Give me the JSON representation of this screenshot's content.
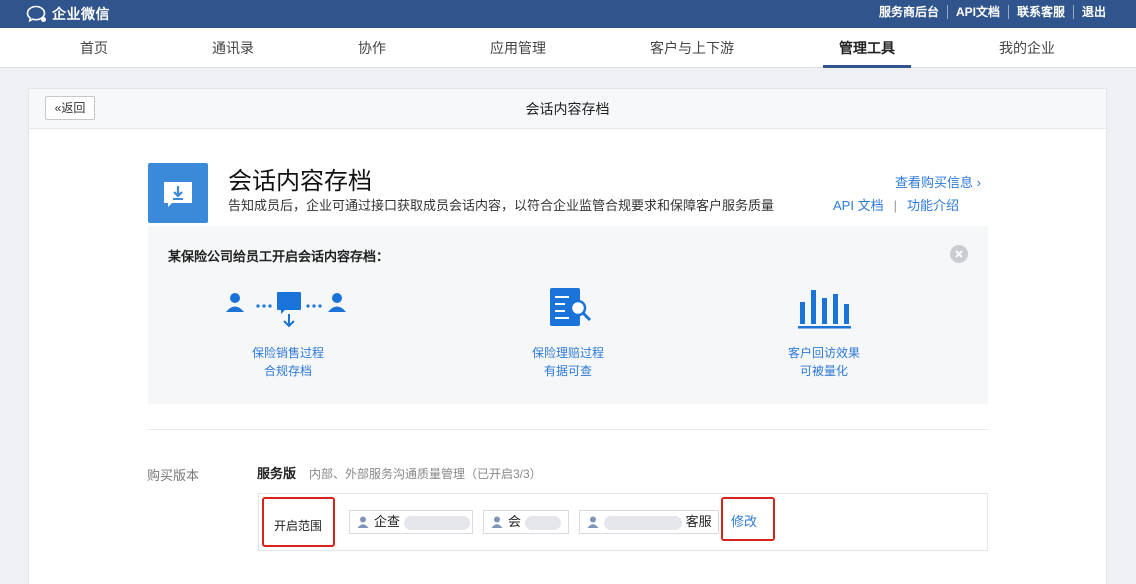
{
  "topbar": {
    "brand": "企业微信",
    "links": [
      "服务商后台",
      "API文档",
      "联系客服",
      "退出"
    ]
  },
  "nav": {
    "items": [
      "首页",
      "通讯录",
      "协作",
      "应用管理",
      "客户与上下游",
      "管理工具",
      "我的企业"
    ],
    "active": "管理工具"
  },
  "panel": {
    "back_label": "返回",
    "title": "会话内容存档"
  },
  "hero": {
    "title": "会话内容存档",
    "description": "告知成员后，企业可通过接口获取成员会话内容，以符合企业监管合规要求和保障客户服务质量",
    "buy_link": "查看购买信息",
    "api_doc": "API 文档",
    "intro": "功能介绍"
  },
  "promo": {
    "title": "某保险公司给员工开启会话内容存档：",
    "features": [
      {
        "icon": "transfer-icon",
        "line1": "保险销售过程",
        "line2": "合规存档"
      },
      {
        "icon": "document-search-icon",
        "line1": "保险理赔过程",
        "line2": "有据可查"
      },
      {
        "icon": "bar-chart-icon",
        "line1": "客户回访效果",
        "line2": "可被量化"
      }
    ]
  },
  "purchase": {
    "label": "购买版本",
    "plan_name": "服务版",
    "plan_desc": "内部、外部服务沟通质量管理（已开启3/3）",
    "scope_label": "开启范围",
    "members": [
      "企查",
      "会",
      "客服"
    ],
    "edit_label": "修改"
  },
  "colors": {
    "topbar": "#30558c",
    "accent": "#2e7ad8",
    "highlight": "#d9221c"
  }
}
